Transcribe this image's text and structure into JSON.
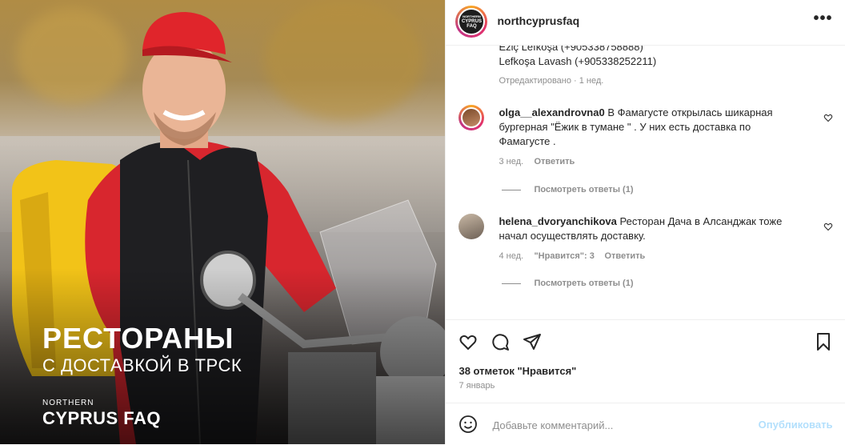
{
  "post": {
    "overlay_title": "РЕСТОРАНЫ",
    "overlay_subtitle": "С ДОСТАВКОЙ В ТРСК",
    "brand_small": "NORTHERN",
    "brand_big": "CYPRUS FAQ"
  },
  "header": {
    "avatar_text_1": "NORTHERN",
    "avatar_text_2": "CYPRUS",
    "avatar_text_3": "FAQ",
    "username": "northcyprusfaq",
    "more_label": "•••"
  },
  "comments": {
    "caption_line_1": "Eziç Lefkoşa (+905338758888)",
    "caption_line_2": "Lefkoşa Lavash (+905338252211)",
    "caption_meta": "Отредактировано · 1 нед.",
    "items": [
      {
        "username": "olga__alexandrovna0",
        "text_1": "В Фамагусте открылась шикарная",
        "text_2": "бургерная \"Ёжик в тумане \" . У них есть доставка по",
        "text_3": "Фамагусте .",
        "age": "3 нед.",
        "reply_label": "Ответить",
        "view_replies": "Посмотреть ответы (1)"
      },
      {
        "username": "helena_dvoryanchikova",
        "text_1": "Ресторан Дача в Алсанджак тоже",
        "text_2": "начал осуществлять доставку.",
        "age": "4 нед.",
        "likes_label": "\"Нравится\": 3",
        "reply_label": "Ответить",
        "view_replies": "Посмотреть ответы (1)"
      }
    ]
  },
  "actions": {
    "likes": "38 отметок \"Нравится\"",
    "date": "7 январь"
  },
  "composer": {
    "placeholder": "Добавьте комментарий...",
    "post_label": "Опубликовать"
  },
  "colors": {
    "link_disabled": "#b2dffc",
    "muted": "#8e8e8e",
    "text": "#262626",
    "helmet": "#e0252b",
    "bag": "#f2c318"
  }
}
